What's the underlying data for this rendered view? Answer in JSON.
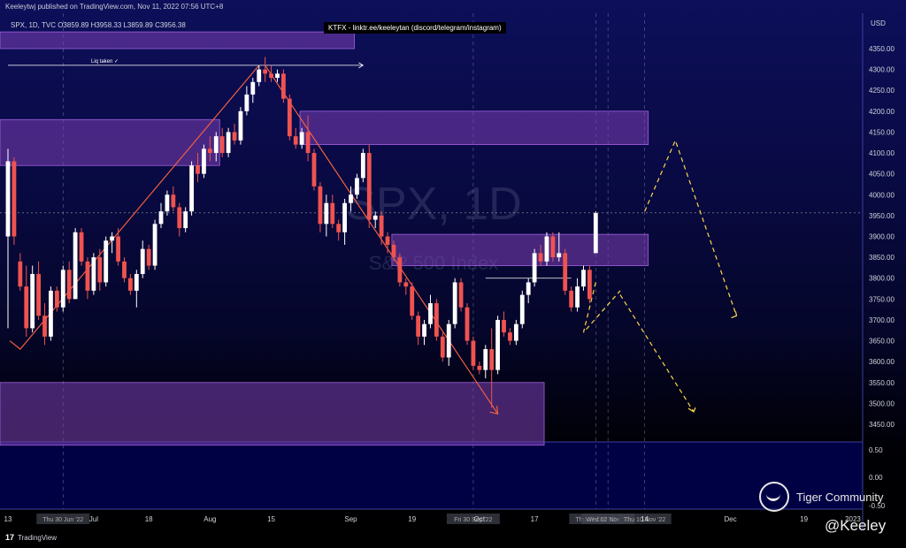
{
  "header": {
    "published": "Keeleytwj published on TradingView.com, Nov 11, 2022 07:56 UTC+8",
    "symbol_line": "SPX, 1D, TVC  O3859.89  H3958.33  L3859.89  C3956.38",
    "banner": "KTFX - linktr.ee/keeleytan (discord/telegram/instagram)"
  },
  "footer": {
    "tradingview": "TradingView",
    "community": "Tiger Community",
    "handle": "@Keeley",
    "tv_mark": "17"
  },
  "colors": {
    "up": "#ffffff",
    "down": "#ef5350",
    "zone": "#7b3fb5",
    "accent_line": "#ef5f3f",
    "projection": "#ffd84a"
  },
  "chart_data": {
    "type": "candlestick",
    "title": "",
    "xlabel": "",
    "ylabel": "",
    "currency": "USD",
    "ylim": [
      3400,
      4390
    ],
    "y_ticks": [
      4350,
      4300,
      4250,
      4200,
      4150,
      4100,
      4050,
      4000,
      3950,
      3900,
      3850,
      3800,
      3750,
      3700,
      3650,
      3600,
      3550,
      3500,
      3450
    ],
    "last_price": 3956.38,
    "watermark": {
      "symbol": "SPX, 1D",
      "name": "S&P 500 Index"
    },
    "x_ticks": [
      {
        "i": 0,
        "label": "13"
      },
      {
        "i": 9,
        "label": "Thu 30 Jun '22"
      },
      {
        "i": 14,
        "label": "Jul"
      },
      {
        "i": 23,
        "label": "18"
      },
      {
        "i": 33,
        "label": "Aug"
      },
      {
        "i": 43,
        "label": "15"
      },
      {
        "i": 56,
        "label": "Sep"
      },
      {
        "i": 66,
        "label": "19"
      },
      {
        "i": 76,
        "label": "Fri 30 Sep '22"
      },
      {
        "i": 77,
        "label": "Oct"
      },
      {
        "i": 86,
        "label": "17"
      },
      {
        "i": 96,
        "label": "Thu 27 Oct '22"
      },
      {
        "i": 98,
        "label": "Wed 02 Nov '22"
      },
      {
        "i": 104,
        "label": "Thu 10 Nov '22"
      },
      {
        "i": 104,
        "label": "14"
      },
      {
        "i": 118,
        "label": "Dec"
      },
      {
        "i": 130,
        "label": "19"
      },
      {
        "i": 138,
        "label": "2023"
      }
    ],
    "candles": [
      [
        3900,
        4110,
        3680,
        4080
      ],
      [
        4080,
        4090,
        3880,
        3900
      ],
      [
        3840,
        3860,
        3770,
        3780
      ],
      [
        3780,
        3830,
        3660,
        3680
      ],
      [
        3680,
        3830,
        3670,
        3810
      ],
      [
        3810,
        3840,
        3700,
        3710
      ],
      [
        3710,
        3740,
        3640,
        3660
      ],
      [
        3660,
        3780,
        3650,
        3770
      ],
      [
        3770,
        3780,
        3720,
        3730
      ],
      [
        3730,
        3830,
        3720,
        3820
      ],
      [
        3820,
        3840,
        3740,
        3750
      ],
      [
        3750,
        3920,
        3750,
        3910
      ],
      [
        3910,
        3920,
        3830,
        3840
      ],
      [
        3840,
        3850,
        3750,
        3770
      ],
      [
        3770,
        3860,
        3760,
        3850
      ],
      [
        3850,
        3870,
        3770,
        3790
      ],
      [
        3790,
        3900,
        3780,
        3890
      ],
      [
        3890,
        3910,
        3860,
        3900
      ],
      [
        3900,
        3920,
        3830,
        3840
      ],
      [
        3840,
        3850,
        3790,
        3800
      ],
      [
        3800,
        3810,
        3760,
        3770
      ],
      [
        3770,
        3820,
        3730,
        3810
      ],
      [
        3810,
        3890,
        3800,
        3870
      ],
      [
        3870,
        3880,
        3820,
        3830
      ],
      [
        3830,
        3940,
        3820,
        3930
      ],
      [
        3930,
        3980,
        3920,
        3960
      ],
      [
        3960,
        4010,
        3950,
        4000
      ],
      [
        4000,
        4020,
        3960,
        3970
      ],
      [
        3970,
        3980,
        3900,
        3920
      ],
      [
        3920,
        3970,
        3910,
        3960
      ],
      [
        3960,
        4080,
        3950,
        4070
      ],
      [
        4070,
        4100,
        4030,
        4050
      ],
      [
        4050,
        4120,
        4040,
        4110
      ],
      [
        4110,
        4140,
        4080,
        4100
      ],
      [
        4100,
        4150,
        4080,
        4140
      ],
      [
        4140,
        4160,
        4090,
        4100
      ],
      [
        4100,
        4160,
        4090,
        4150
      ],
      [
        4150,
        4170,
        4120,
        4130
      ],
      [
        4130,
        4210,
        4120,
        4200
      ],
      [
        4200,
        4260,
        4190,
        4240
      ],
      [
        4240,
        4280,
        4220,
        4270
      ],
      [
        4270,
        4310,
        4260,
        4300
      ],
      [
        4300,
        4330,
        4270,
        4290
      ],
      [
        4290,
        4310,
        4270,
        4280
      ],
      [
        4280,
        4300,
        4270,
        4290
      ],
      [
        4290,
        4300,
        4220,
        4230
      ],
      [
        4230,
        4240,
        4130,
        4140
      ],
      [
        4140,
        4160,
        4110,
        4120
      ],
      [
        4120,
        4160,
        4110,
        4150
      ],
      [
        4150,
        4190,
        4080,
        4100
      ],
      [
        4100,
        4110,
        4010,
        4020
      ],
      [
        4020,
        4030,
        3910,
        3930
      ],
      [
        3930,
        4000,
        3900,
        3980
      ],
      [
        3980,
        4000,
        3920,
        3930
      ],
      [
        3930,
        3940,
        3890,
        3910
      ],
      [
        3910,
        3990,
        3880,
        3980
      ],
      [
        3980,
        4020,
        3960,
        4000
      ],
      [
        4000,
        4050,
        3990,
        4040
      ],
      [
        4040,
        4110,
        4030,
        4100
      ],
      [
        4100,
        4120,
        3920,
        3940
      ],
      [
        3940,
        3960,
        3920,
        3950
      ],
      [
        3950,
        3960,
        3880,
        3900
      ],
      [
        3900,
        3910,
        3860,
        3880
      ],
      [
        3880,
        3890,
        3840,
        3850
      ],
      [
        3850,
        3860,
        3780,
        3790
      ],
      [
        3790,
        3800,
        3760,
        3780
      ],
      [
        3780,
        3790,
        3700,
        3710
      ],
      [
        3710,
        3720,
        3640,
        3660
      ],
      [
        3660,
        3700,
        3640,
        3690
      ],
      [
        3690,
        3760,
        3680,
        3740
      ],
      [
        3740,
        3750,
        3650,
        3660
      ],
      [
        3660,
        3670,
        3600,
        3610
      ],
      [
        3610,
        3700,
        3590,
        3690
      ],
      [
        3690,
        3800,
        3680,
        3790
      ],
      [
        3790,
        3800,
        3720,
        3730
      ],
      [
        3730,
        3740,
        3640,
        3650
      ],
      [
        3650,
        3660,
        3580,
        3590
      ],
      [
        3590,
        3600,
        3570,
        3580
      ],
      [
        3580,
        3640,
        3560,
        3630
      ],
      [
        3630,
        3680,
        3490,
        3580
      ],
      [
        3580,
        3710,
        3570,
        3700
      ],
      [
        3700,
        3720,
        3660,
        3670
      ],
      [
        3670,
        3680,
        3640,
        3650
      ],
      [
        3650,
        3700,
        3640,
        3690
      ],
      [
        3690,
        3770,
        3680,
        3760
      ],
      [
        3760,
        3800,
        3740,
        3790
      ],
      [
        3790,
        3870,
        3780,
        3860
      ],
      [
        3860,
        3880,
        3830,
        3840
      ],
      [
        3840,
        3910,
        3830,
        3900
      ],
      [
        3900,
        3910,
        3840,
        3850
      ],
      [
        3850,
        3910,
        3840,
        3860
      ],
      [
        3860,
        3870,
        3760,
        3770
      ],
      [
        3770,
        3780,
        3720,
        3730
      ],
      [
        3730,
        3800,
        3720,
        3780
      ],
      [
        3780,
        3830,
        3770,
        3820
      ],
      [
        3820,
        3830,
        3740,
        3750
      ],
      [
        3860,
        3960,
        3860,
        3956
      ]
    ],
    "zones": [
      {
        "low": 4350,
        "high": 4390,
        "start": 0,
        "end": 56
      },
      {
        "low": 4070,
        "high": 4180,
        "start": 0,
        "end": 34
      },
      {
        "low": 4120,
        "high": 4200,
        "start": 49,
        "end": 104
      },
      {
        "low": 3830,
        "high": 3905,
        "start": 64,
        "end": 104
      },
      {
        "low": 3400,
        "high": 3550,
        "start": 0,
        "end": 87
      }
    ],
    "annotations": [
      {
        "label": "Liq taken ✓",
        "price": 4310,
        "start": 0,
        "end": 58
      }
    ],
    "oscillator": {
      "y_ticks": [
        "0.50",
        "0.00",
        "-0.50"
      ]
    }
  }
}
